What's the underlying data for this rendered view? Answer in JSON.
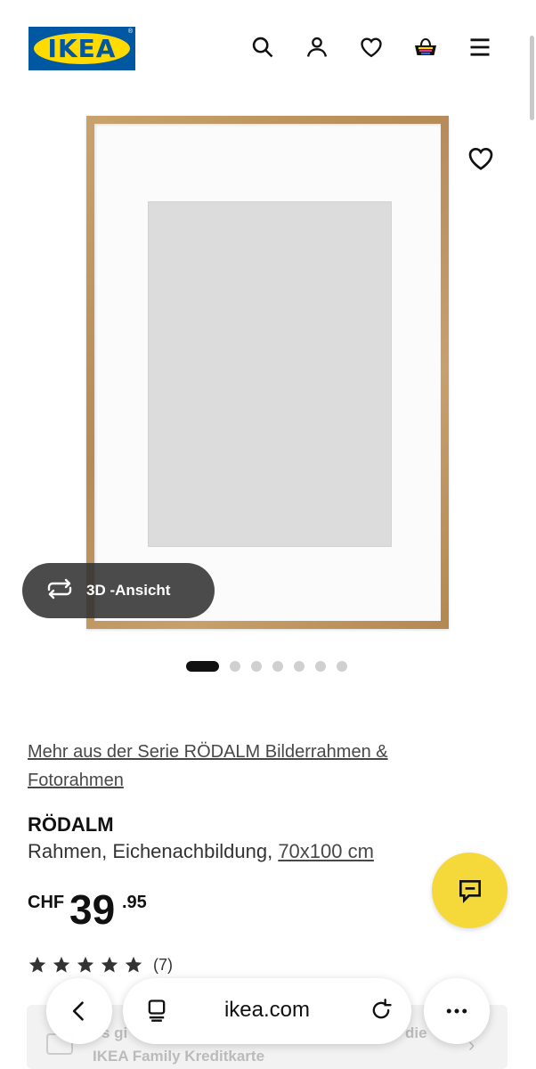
{
  "header": {
    "logo_text": "IKEA",
    "icons": [
      "search-icon",
      "account-icon",
      "heart-icon",
      "basket-icon",
      "menu-icon"
    ]
  },
  "gallery": {
    "view_3d_label": "3D -Ansicht",
    "image_count": 7,
    "active_index": 0
  },
  "product": {
    "series_link": "Mehr aus der Serie RÖDALM Bilderrahmen & Fotorahmen",
    "name": "RÖDALM",
    "description": "Rahmen, Eichenachbildung,",
    "size_link": "70x100 cm",
    "price": {
      "currency": "CHF",
      "integer": "39",
      "decimal": ".95"
    },
    "rating": {
      "stars": 5,
      "count": "(7)"
    }
  },
  "promo": {
    "line1_start": "s gi",
    "line1_end": "die",
    "line2": "IKEA Family Kreditkarte"
  },
  "browser": {
    "domain": "ikea.com"
  },
  "colors": {
    "ikea_blue": "#0058a3",
    "ikea_yellow": "#ffdb00",
    "chat_yellow": "#f5d83a"
  }
}
